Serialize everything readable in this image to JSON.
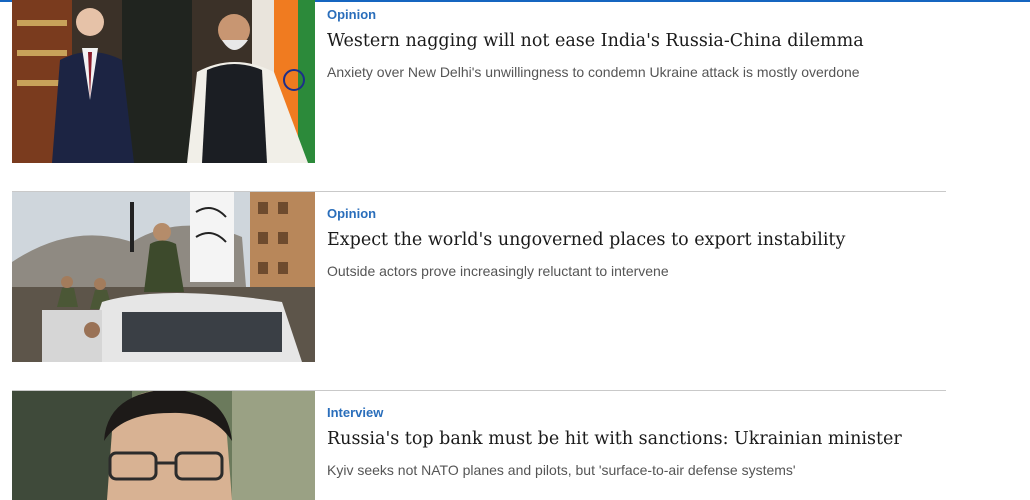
{
  "articles": [
    {
      "label": "Opinion",
      "headline": "Western nagging will not ease India's Russia-China dilemma",
      "summary": "Anxiety over New Delhi's unwillingness to condemn Ukraine attack is mostly overdone"
    },
    {
      "label": "Opinion",
      "headline": "Expect the world's ungoverned places to export instability",
      "summary": "Outside actors prove increasingly reluctant to intervene"
    },
    {
      "label": "Interview",
      "headline": "Russia's top bank must be hit with sanctions: Ukrainian minister",
      "summary": "Kyiv seeks not NATO planes and pilots, but 'surface-to-air defense systems'"
    }
  ]
}
